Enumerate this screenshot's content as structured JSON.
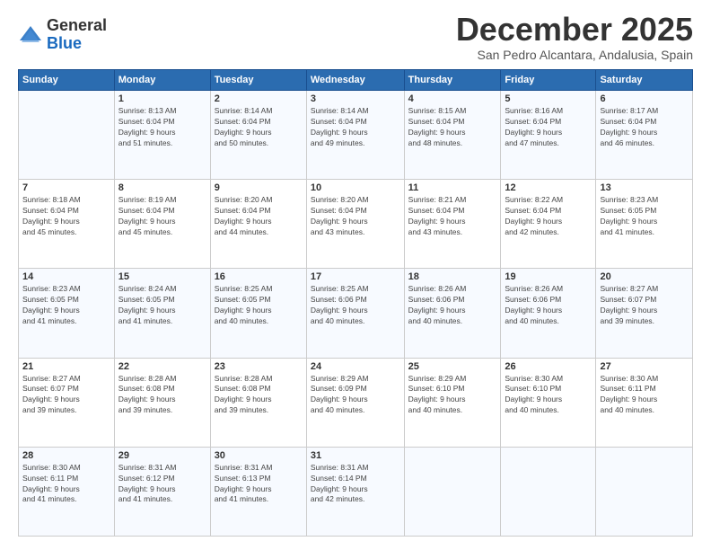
{
  "logo": {
    "general": "General",
    "blue": "Blue"
  },
  "title": "December 2025",
  "location": "San Pedro Alcantara, Andalusia, Spain",
  "weekdays": [
    "Sunday",
    "Monday",
    "Tuesday",
    "Wednesday",
    "Thursday",
    "Friday",
    "Saturday"
  ],
  "weeks": [
    [
      {
        "day": "",
        "info": ""
      },
      {
        "day": "1",
        "info": "Sunrise: 8:13 AM\nSunset: 6:04 PM\nDaylight: 9 hours\nand 51 minutes."
      },
      {
        "day": "2",
        "info": "Sunrise: 8:14 AM\nSunset: 6:04 PM\nDaylight: 9 hours\nand 50 minutes."
      },
      {
        "day": "3",
        "info": "Sunrise: 8:14 AM\nSunset: 6:04 PM\nDaylight: 9 hours\nand 49 minutes."
      },
      {
        "day": "4",
        "info": "Sunrise: 8:15 AM\nSunset: 6:04 PM\nDaylight: 9 hours\nand 48 minutes."
      },
      {
        "day": "5",
        "info": "Sunrise: 8:16 AM\nSunset: 6:04 PM\nDaylight: 9 hours\nand 47 minutes."
      },
      {
        "day": "6",
        "info": "Sunrise: 8:17 AM\nSunset: 6:04 PM\nDaylight: 9 hours\nand 46 minutes."
      }
    ],
    [
      {
        "day": "7",
        "info": "Sunrise: 8:18 AM\nSunset: 6:04 PM\nDaylight: 9 hours\nand 45 minutes."
      },
      {
        "day": "8",
        "info": "Sunrise: 8:19 AM\nSunset: 6:04 PM\nDaylight: 9 hours\nand 45 minutes."
      },
      {
        "day": "9",
        "info": "Sunrise: 8:20 AM\nSunset: 6:04 PM\nDaylight: 9 hours\nand 44 minutes."
      },
      {
        "day": "10",
        "info": "Sunrise: 8:20 AM\nSunset: 6:04 PM\nDaylight: 9 hours\nand 43 minutes."
      },
      {
        "day": "11",
        "info": "Sunrise: 8:21 AM\nSunset: 6:04 PM\nDaylight: 9 hours\nand 43 minutes."
      },
      {
        "day": "12",
        "info": "Sunrise: 8:22 AM\nSunset: 6:04 PM\nDaylight: 9 hours\nand 42 minutes."
      },
      {
        "day": "13",
        "info": "Sunrise: 8:23 AM\nSunset: 6:05 PM\nDaylight: 9 hours\nand 41 minutes."
      }
    ],
    [
      {
        "day": "14",
        "info": "Sunrise: 8:23 AM\nSunset: 6:05 PM\nDaylight: 9 hours\nand 41 minutes."
      },
      {
        "day": "15",
        "info": "Sunrise: 8:24 AM\nSunset: 6:05 PM\nDaylight: 9 hours\nand 41 minutes."
      },
      {
        "day": "16",
        "info": "Sunrise: 8:25 AM\nSunset: 6:05 PM\nDaylight: 9 hours\nand 40 minutes."
      },
      {
        "day": "17",
        "info": "Sunrise: 8:25 AM\nSunset: 6:06 PM\nDaylight: 9 hours\nand 40 minutes."
      },
      {
        "day": "18",
        "info": "Sunrise: 8:26 AM\nSunset: 6:06 PM\nDaylight: 9 hours\nand 40 minutes."
      },
      {
        "day": "19",
        "info": "Sunrise: 8:26 AM\nSunset: 6:06 PM\nDaylight: 9 hours\nand 40 minutes."
      },
      {
        "day": "20",
        "info": "Sunrise: 8:27 AM\nSunset: 6:07 PM\nDaylight: 9 hours\nand 39 minutes."
      }
    ],
    [
      {
        "day": "21",
        "info": "Sunrise: 8:27 AM\nSunset: 6:07 PM\nDaylight: 9 hours\nand 39 minutes."
      },
      {
        "day": "22",
        "info": "Sunrise: 8:28 AM\nSunset: 6:08 PM\nDaylight: 9 hours\nand 39 minutes."
      },
      {
        "day": "23",
        "info": "Sunrise: 8:28 AM\nSunset: 6:08 PM\nDaylight: 9 hours\nand 39 minutes."
      },
      {
        "day": "24",
        "info": "Sunrise: 8:29 AM\nSunset: 6:09 PM\nDaylight: 9 hours\nand 40 minutes."
      },
      {
        "day": "25",
        "info": "Sunrise: 8:29 AM\nSunset: 6:10 PM\nDaylight: 9 hours\nand 40 minutes."
      },
      {
        "day": "26",
        "info": "Sunrise: 8:30 AM\nSunset: 6:10 PM\nDaylight: 9 hours\nand 40 minutes."
      },
      {
        "day": "27",
        "info": "Sunrise: 8:30 AM\nSunset: 6:11 PM\nDaylight: 9 hours\nand 40 minutes."
      }
    ],
    [
      {
        "day": "28",
        "info": "Sunrise: 8:30 AM\nSunset: 6:11 PM\nDaylight: 9 hours\nand 41 minutes."
      },
      {
        "day": "29",
        "info": "Sunrise: 8:31 AM\nSunset: 6:12 PM\nDaylight: 9 hours\nand 41 minutes."
      },
      {
        "day": "30",
        "info": "Sunrise: 8:31 AM\nSunset: 6:13 PM\nDaylight: 9 hours\nand 41 minutes."
      },
      {
        "day": "31",
        "info": "Sunrise: 8:31 AM\nSunset: 6:14 PM\nDaylight: 9 hours\nand 42 minutes."
      },
      {
        "day": "",
        "info": ""
      },
      {
        "day": "",
        "info": ""
      },
      {
        "day": "",
        "info": ""
      }
    ]
  ]
}
